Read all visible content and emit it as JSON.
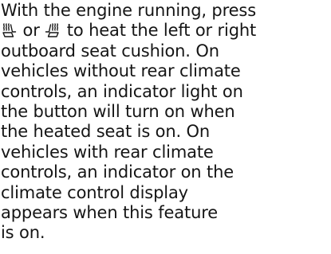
{
  "paragraph": {
    "lines": [
      "With the engine running, press",
      "or",
      "to heat the left or right",
      "outboard seat cushion. On",
      "vehicles without rear climate",
      "controls, an indicator light on",
      "the button will turn on when",
      "the heated seat is on. On",
      "vehicles with rear climate",
      "controls, an indicator on the",
      "climate control display",
      "appears when this feature",
      "is on."
    ]
  },
  "icons": {
    "left": "heated-seat-left-icon",
    "right": "heated-seat-right-icon"
  }
}
